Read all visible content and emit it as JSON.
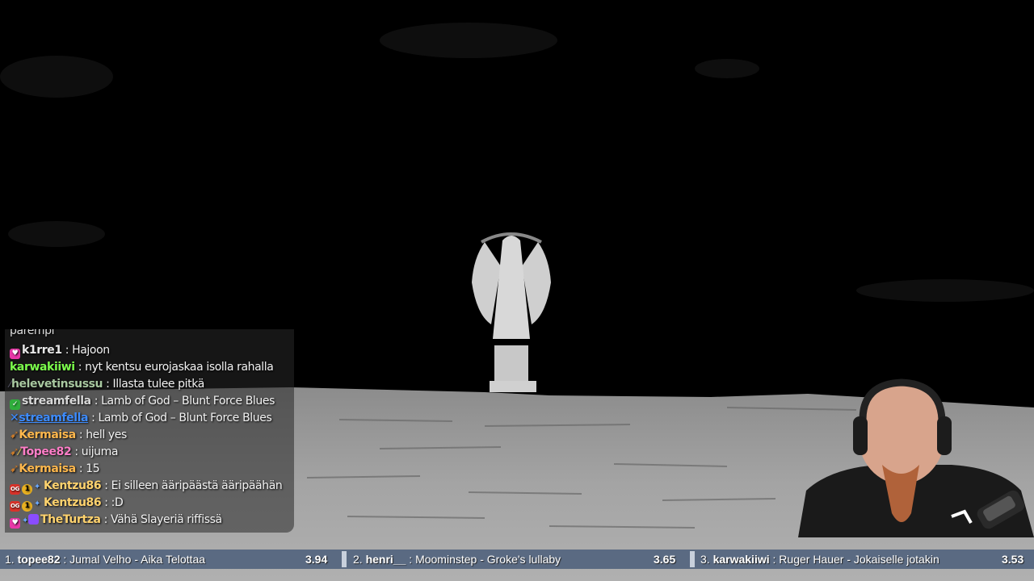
{
  "chat": {
    "partial_top": "parempi",
    "messages": [
      {
        "user": "k1rre1",
        "text": "Hajoon",
        "color": "#e8e8e8",
        "badges": [
          "heart-badge"
        ]
      },
      {
        "user": "karwakiiwi",
        "text": "nyt kentsu eurojaskaa isolla rahalla",
        "color": "#7cff4c",
        "badges": []
      },
      {
        "user": "helevetinsussu",
        "text": "Illasta tulee pitkä",
        "color": "#a8c8a0",
        "badges": [
          "sword-badge"
        ]
      },
      {
        "user": "streamfella",
        "text": "Lamb of God – Blunt Force Blues",
        "color": "#d8d8d8",
        "badges": [
          "check-badge"
        ]
      },
      {
        "user": "streamfella",
        "text": "Lamb of God – Blunt Force Blues",
        "color": "#3d8cff",
        "badges": [
          "sword-badge"
        ]
      },
      {
        "user": "Kermaisa",
        "text": "hell yes",
        "color": "#ffb84d",
        "badges": [
          "gun-badge"
        ]
      },
      {
        "user": "Topee82",
        "text": "uijuma",
        "color": "#ff7ec8",
        "badges": [
          "gun-badge",
          "wand-badge"
        ]
      },
      {
        "user": "Kermaisa",
        "text": "15",
        "color": "#ffb84d",
        "badges": [
          "gun-badge"
        ]
      },
      {
        "user": "Kentzu86",
        "text": "Ei silleen ääripäästä ääripäähän",
        "color": "#ffd36e",
        "badges": [
          "og-badge",
          "one-badge",
          "star-badge"
        ]
      },
      {
        "user": "Kentzu86",
        "text": ":D",
        "color": "#ffd36e",
        "badges": [
          "og-badge",
          "one-badge",
          "star-badge"
        ]
      },
      {
        "user": "TheTurtza",
        "text": "Vähä Slayeriä riffissä",
        "color": "#ffd36e",
        "badges": [
          "heart-badge",
          "star-badge",
          "sub-badge"
        ]
      }
    ]
  },
  "leaderboard": [
    {
      "rank": "1.",
      "user": "topee82",
      "song": "Jumal Velho - Aika Telottaa",
      "score": "3.94"
    },
    {
      "rank": "2.",
      "user": "henri__",
      "song": "Moominstep - Groke's lullaby",
      "score": "3.65"
    },
    {
      "rank": "3.",
      "user": "karwakiiwi",
      "song": "Ruger Hauer - Jokaiselle jotakin",
      "score": "3.53"
    }
  ],
  "colors": {
    "bar": "#5a6a82",
    "ground": "#9a9a9a",
    "sky": "#000000"
  }
}
